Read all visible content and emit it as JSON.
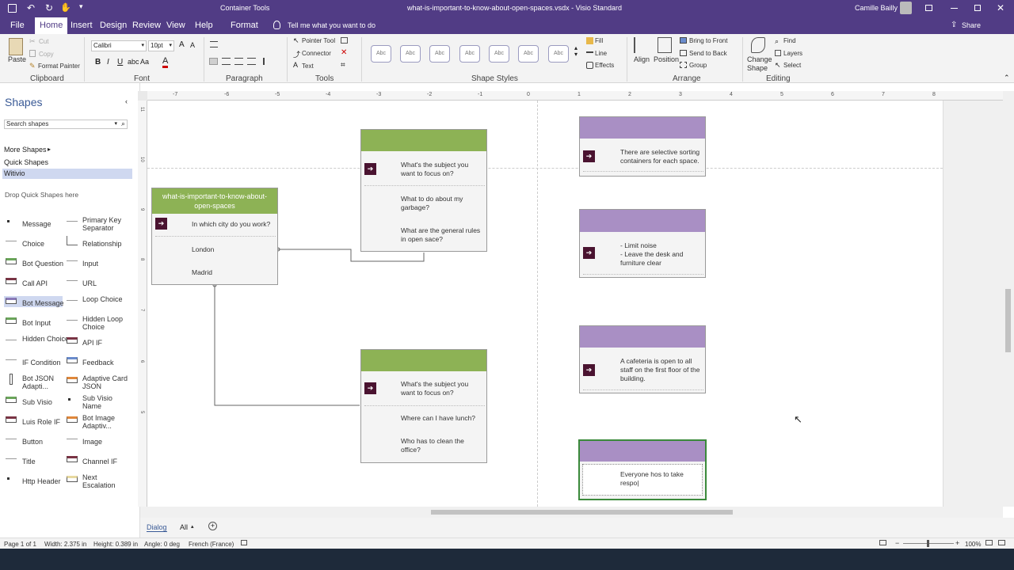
{
  "titlebar": {
    "context_tools": "Container Tools",
    "document_title": "what-is-important-to-know-about-open-spaces.vsdx - Visio Standard",
    "user_name": "Camille Bailly"
  },
  "tabs": [
    {
      "label": "File"
    },
    {
      "label": "Home"
    },
    {
      "label": "Insert"
    },
    {
      "label": "Design"
    },
    {
      "label": "Review"
    },
    {
      "label": "View"
    },
    {
      "label": "Help"
    },
    {
      "label": "Format"
    }
  ],
  "tell_me": "Tell me what you want to do",
  "share_label": "Share",
  "ribbon": {
    "clipboard": {
      "group": "Clipboard",
      "paste": "Paste",
      "cut": "Cut",
      "copy": "Copy",
      "format_painter": "Format Painter"
    },
    "font": {
      "group": "Font",
      "font_name": "Calibri",
      "font_size": "10pt"
    },
    "paragraph": {
      "group": "Paragraph"
    },
    "tools": {
      "group": "Tools",
      "pointer": "Pointer Tool",
      "connector": "Connector",
      "text": "Text"
    },
    "shape_styles": {
      "group": "Shape Styles",
      "sample": "Abc",
      "fill": "Fill",
      "line": "Line",
      "effects": "Effects"
    },
    "arrange": {
      "group": "Arrange",
      "align": "Align",
      "position": "Position",
      "bring_front": "Bring to Front",
      "send_back": "Send to Back",
      "group_btn": "Group"
    },
    "editing": {
      "group": "Editing",
      "change_shape": "Change Shape",
      "find": "Find",
      "layers": "Layers",
      "select": "Select"
    }
  },
  "shapes_pane": {
    "title": "Shapes",
    "search_placeholder": "Search shapes",
    "more_shapes": "More Shapes",
    "quick_shapes": "Quick Shapes",
    "witivio": "Witivio",
    "drop_here": "Drop Quick Shapes here",
    "items_left": [
      "Message",
      "Choice",
      "Bot Question",
      "Call API",
      "Bot Message",
      "Bot Input",
      "Hidden Choice",
      "IF Condition",
      "Bot JSON Adapti...",
      "Sub Visio",
      "Luis Role IF",
      "Button",
      "Title",
      "Http Header"
    ],
    "items_right": [
      "Primary Key Separator",
      "Relationship",
      "Input",
      "URL",
      "Loop Choice",
      "Hidden Loop Choice",
      "API IF",
      "Feedback",
      "Adaptive Card JSON",
      "Sub Visio Name",
      "Bot Image Adaptiv...",
      "Image",
      "Channel IF",
      "Next Escalation"
    ]
  },
  "ruler_h": [
    "-7",
    "-6",
    "-5",
    "-4",
    "-3",
    "-2",
    "-1",
    "0",
    "1",
    "2",
    "3",
    "4",
    "5",
    "6",
    "7",
    "8"
  ],
  "ruler_v": [
    "11",
    "10",
    "9",
    "8",
    "7",
    "6",
    "5"
  ],
  "diagram": {
    "main": {
      "title": "what-is-important-to-know-about-open-spaces",
      "question": "In which city do you work?",
      "options": [
        "London",
        "Madrid"
      ]
    },
    "london_box": {
      "question": "What's the subject you want to focus on?",
      "options": [
        "What to do about my garbage?",
        "What are the general rules in open sace?"
      ]
    },
    "madrid_box": {
      "question": "What's the subject you want to focus on?",
      "options": [
        "Where can I have lunch?",
        "Who has to clean the office?"
      ]
    },
    "answers": [
      "There are selective sorting containers for each space.",
      "- Limit noise\n- Leave the desk and furniture clear",
      "A cafeteria is open to all staff on the first floor of the building.",
      "Everyone hos to take respo|"
    ]
  },
  "page_tabs": {
    "dialog": "Dialog",
    "all": "All"
  },
  "status": {
    "page": "Page 1 of 1",
    "width": "Width: 2.375 in",
    "height": "Height: 0.389 in",
    "angle": "Angle: 0 deg",
    "language": "French (France)",
    "zoom": "100%"
  },
  "colors": {
    "accent": "#513C85",
    "green_header": "#8DB255",
    "purple_header": "#A98FC4",
    "arrow_box": "#4A1330"
  }
}
